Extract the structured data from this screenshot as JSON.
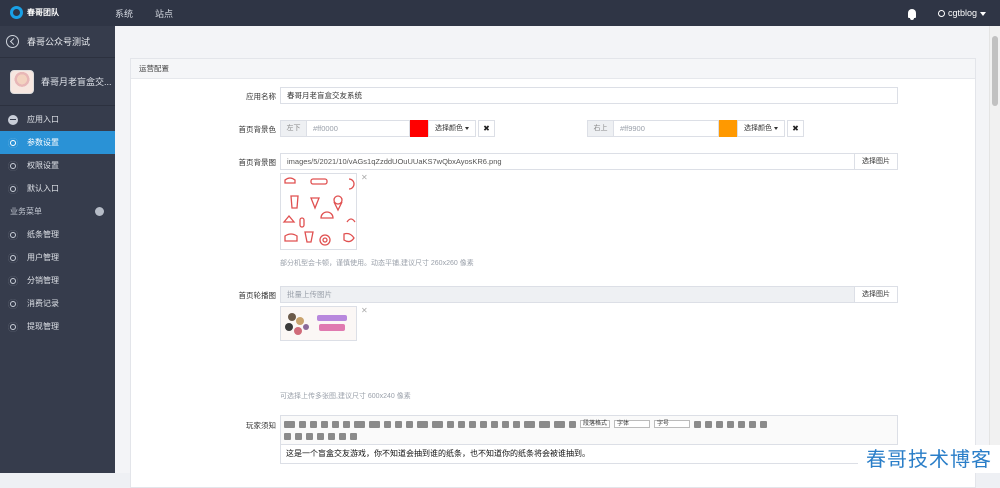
{
  "topbar": {
    "brand": "春哥团队",
    "nav": [
      "系统",
      "站点"
    ],
    "user": "cgtblog"
  },
  "sidebar": {
    "back_label": "春哥公众号测试",
    "app_name": "春哥月老盲盒交...",
    "menu": [
      {
        "label": "应用入口",
        "icon": "chat-icon",
        "active": false
      },
      {
        "label": "参数设置",
        "icon": "gear-icon",
        "active": true
      },
      {
        "label": "权限设置",
        "icon": "gear-icon",
        "active": false
      },
      {
        "label": "默认入口",
        "icon": "gear-icon",
        "active": false
      }
    ],
    "section_label": "业务菜单",
    "business_menu": [
      {
        "label": "纸条管理",
        "icon": "gear-icon"
      },
      {
        "label": "用户管理",
        "icon": "gear-icon"
      },
      {
        "label": "分销管理",
        "icon": "gear-icon"
      },
      {
        "label": "消费记录",
        "icon": "gear-icon"
      },
      {
        "label": "提现管理",
        "icon": "gear-icon"
      }
    ]
  },
  "form": {
    "panel_title": "运营配置",
    "app_name_label": "应用名称",
    "app_name_value": "春哥月老盲盒交友系统",
    "bg_color_label": "首页背景色",
    "color1_addon": "左下",
    "color1_placeholder": "#ff0000",
    "color1_swatch": "#ff0000",
    "color2_addon": "右上",
    "color2_placeholder": "#ff9900",
    "color2_swatch": "#ff9900",
    "choose_color_label": "选择颜色",
    "clear_label": "✖",
    "bg_image_label": "首页背景图",
    "bg_image_value": "images/5/2021/10/vAGs1qZzddUOuUUaKS7wQbxAyosKR6.png",
    "choose_image_label": "选择图片",
    "bg_image_help": "部分机型会卡顿，谨慎使用。动态平铺,建议尺寸 260x260 像素",
    "carousel_label": "首页轮播图",
    "carousel_placeholder": "批量上传图片",
    "carousel_help": "可选择上传多张图,建议尺寸 600x240 像素",
    "rules_label": "玩家须知",
    "editor_text": "这是一个盲盒交友游戏，你不知道会抽到谁的纸条，也不知道你的纸条将会被谁抽到。",
    "toolbar_selects": [
      "段落格式",
      "字体",
      "字号"
    ]
  },
  "watermark": "春哥技术博客"
}
